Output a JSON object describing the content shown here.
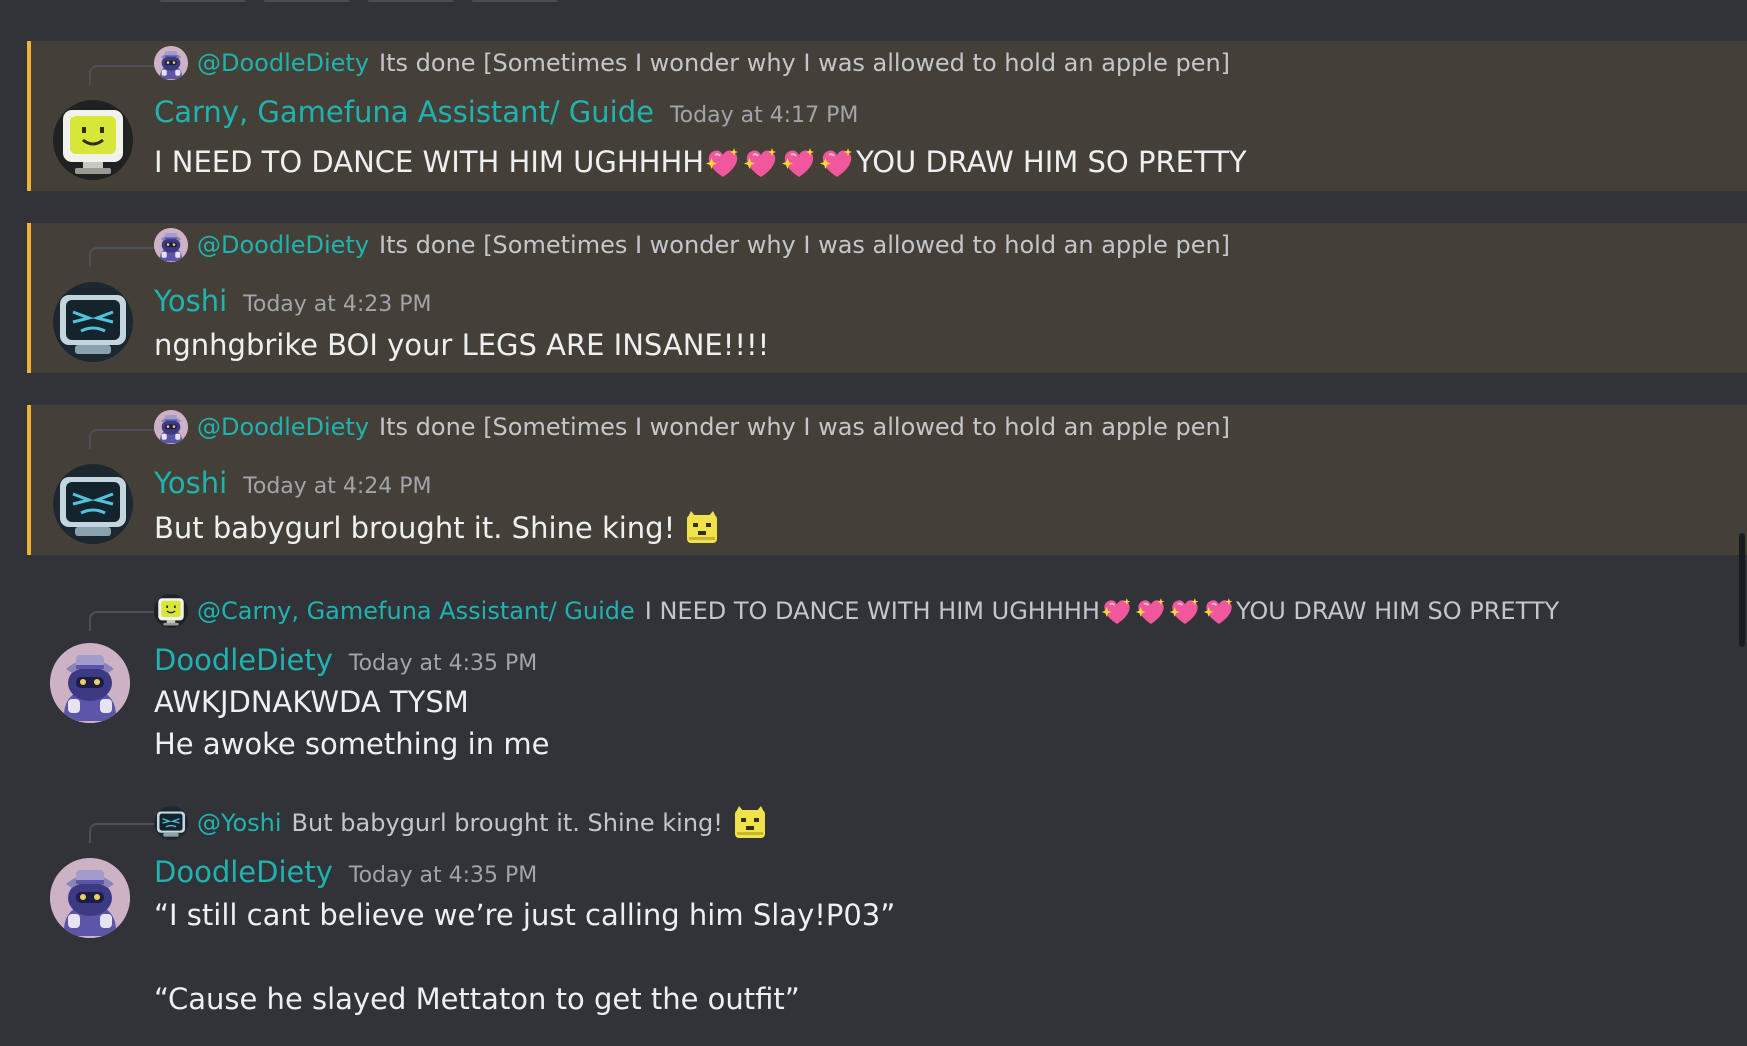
{
  "colors": {
    "background": "#313338",
    "mention_highlight": "#444038",
    "mention_bar": "#f0b232",
    "username": "#1fb3b0",
    "timestamp": "#a2a4ab",
    "body_text": "#eeeff1"
  },
  "messages": [
    {
      "highlighted": true,
      "reply": {
        "avatar_icon": "knight-avatar-icon",
        "mention": "@DoodleDiety",
        "text": "Its done [Sometimes I wonder why I was allowed to hold an apple pen]"
      },
      "avatar_icon": "tv-smile-avatar-icon",
      "username": "Carny, Gamefuna Assistant/ Guide",
      "timestamp": "Today at 4:17 PM",
      "lines": [
        {
          "before": "I NEED TO DANCE WITH HIM UGHHHH",
          "emoji": "sparkling-heart-icon",
          "emoji_count": 4,
          "after": " YOU DRAW HIM SO PRETTY"
        }
      ]
    },
    {
      "highlighted": true,
      "reply": {
        "avatar_icon": "knight-avatar-icon",
        "mention": "@DoodleDiety",
        "text": "Its done [Sometimes I wonder why I was allowed to hold an apple pen]"
      },
      "avatar_icon": "tv-face-avatar-icon",
      "username": "Yoshi",
      "timestamp": "Today at 4:23 PM",
      "lines": [
        {
          "before": "ngnhgbrike BOI your LEGS ARE INSANE!!!!"
        }
      ]
    },
    {
      "highlighted": true,
      "reply": {
        "avatar_icon": "knight-avatar-icon",
        "mention": "@DoodleDiety",
        "text": "Its done [Sometimes I wonder why I was allowed to hold an apple pen]"
      },
      "avatar_icon": "tv-face-avatar-icon",
      "username": "Yoshi",
      "timestamp": "Today at 4:24 PM",
      "lines": [
        {
          "before": "But babygurl brought it.  Shine king! ",
          "emoji": "cat-emoji-icon",
          "emoji_count": 1
        }
      ]
    },
    {
      "highlighted": false,
      "reply": {
        "avatar_icon": "tv-smile-avatar-icon",
        "mention": "@Carny, Gamefuna Assistant/ Guide",
        "text": "I NEED TO DANCE WITH HIM UGHHHH",
        "emoji": "sparkling-heart-icon",
        "emoji_count": 4,
        "after": " YOU DRAW HIM SO PRETTY"
      },
      "avatar_icon": "knight-avatar-icon",
      "username": "DoodleDiety",
      "timestamp": "Today at 4:35 PM",
      "lines": [
        {
          "before": "AWKJDNAKWDA TYSM"
        },
        {
          "before": "He awoke something in me"
        }
      ]
    },
    {
      "highlighted": false,
      "reply": {
        "avatar_icon": "tv-face-avatar-icon",
        "mention": "@Yoshi",
        "text": "But babygurl brought it.  Shine king! ",
        "emoji": "cat-emoji-icon",
        "emoji_count": 1
      },
      "avatar_icon": "knight-avatar-icon",
      "username": "DoodleDiety",
      "timestamp": "Today at 4:35 PM",
      "lines": [
        {
          "before": "“I still cant believe we’re just calling him Slay!P03”"
        },
        {
          "before": "“Cause he slayed Mettaton to get the outfit”"
        }
      ]
    }
  ]
}
